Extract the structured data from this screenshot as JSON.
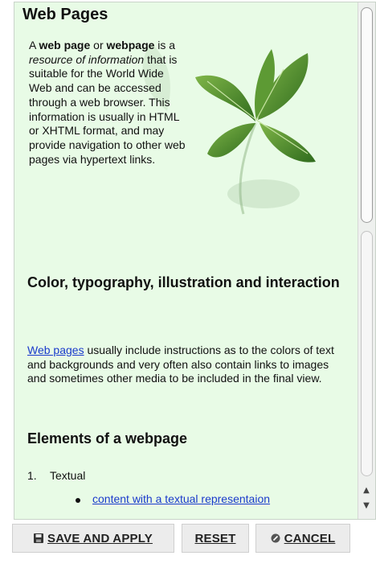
{
  "article": {
    "title": "Web Pages",
    "intro": {
      "p1": "A ",
      "b1": "web page",
      "p2": " or ",
      "b2": "webpage",
      "p3": " is a ",
      "i1": "resource of information",
      "p4": " that is suitable for the World Wide Web and can be accessed through a web browser. This information is usually in HTML or XHTML format, and may provide navigation to other web pages via hypertext links."
    },
    "section2_title": "Color, typography, illustration and interaction",
    "section2_link": "Web pages",
    "section2_text": " usually include instructions as to the colors of text and backgrounds and very often also contain links to images and sometimes other media to be included in the final view.",
    "section3_title": "Elements of a webpage",
    "list": {
      "number": "1.",
      "item": "Textual",
      "subitem": "content with a textual representaion"
    }
  },
  "scrollbar": {
    "up_arrow": "▲",
    "down_arrow": "▼"
  },
  "buttons": {
    "save": "SAVE AND APPLY",
    "reset": "RESET",
    "cancel": "CANCEL"
  },
  "colors": {
    "background": "#e8fbe6",
    "link": "#1a3acb",
    "button_bg": "#ececec"
  },
  "icons": {
    "save": "floppy-disk-icon",
    "cancel": "cancel-circle-icon",
    "image": "mint-leaf-image"
  }
}
